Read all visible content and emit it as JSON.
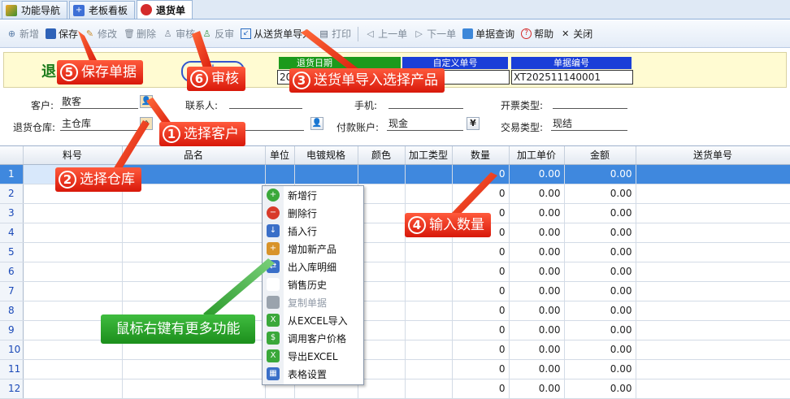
{
  "tabs": [
    {
      "label": "功能导航"
    },
    {
      "label": "老板看板"
    },
    {
      "label": "退货单"
    }
  ],
  "toolbar": {
    "new": "新增",
    "save": "保存",
    "edit": "修改",
    "delete": "删除",
    "audit": "审核",
    "unaudit": "反审",
    "import": "从送货单导入",
    "print": "打印",
    "prev": "上一单",
    "next": "下一单",
    "query": "单据查询",
    "help": "帮助",
    "close": "关闭"
  },
  "header": {
    "title": "退",
    "stamp": "未",
    "return_date_label": "退货日期",
    "return_date_value": "20",
    "custom_no_label": "自定义单号",
    "custom_no_value": "",
    "doc_no_label": "单据编号",
    "doc_no_value": "XT202511140001"
  },
  "form": {
    "customer_label": "客户:",
    "customer_value": "散客",
    "contact_label": "联系人:",
    "contact_value": "",
    "phone_label": "手机:",
    "phone_value": "",
    "invoice_label": "开票类型:",
    "invoice_value": "",
    "warehouse_label": "退货仓库:",
    "warehouse_value": "主仓库",
    "account_label": "付款账户:",
    "account_value": "现金",
    "currency_icon": "¥",
    "trade_label": "交易类型:",
    "trade_value": "现结"
  },
  "grid": {
    "columns": [
      "",
      "料号",
      "品名",
      "单位",
      "电镀规格",
      "颜色",
      "加工类型",
      "数量",
      "加工单价",
      "金额",
      "送货单号"
    ],
    "rows": [
      {
        "n": "1",
        "qty": "0",
        "price": "0.00",
        "amount": "0.00"
      },
      {
        "n": "2",
        "qty": "0",
        "price": "0.00",
        "amount": "0.00"
      },
      {
        "n": "3",
        "qty": "0",
        "price": "0.00",
        "amount": "0.00"
      },
      {
        "n": "4",
        "qty": "0",
        "price": "0.00",
        "amount": "0.00"
      },
      {
        "n": "5",
        "qty": "0",
        "price": "0.00",
        "amount": "0.00"
      },
      {
        "n": "6",
        "qty": "0",
        "price": "0.00",
        "amount": "0.00"
      },
      {
        "n": "7",
        "qty": "0",
        "price": "0.00",
        "amount": "0.00"
      },
      {
        "n": "8",
        "qty": "0",
        "price": "0.00",
        "amount": "0.00"
      },
      {
        "n": "9",
        "qty": "0",
        "price": "0.00",
        "amount": "0.00"
      },
      {
        "n": "10",
        "qty": "0",
        "price": "0.00",
        "amount": "0.00"
      },
      {
        "n": "11",
        "qty": "0",
        "price": "0.00",
        "amount": "0.00"
      },
      {
        "n": "12",
        "qty": "0",
        "price": "0.00",
        "amount": "0.00"
      }
    ]
  },
  "context_menu": {
    "items": [
      {
        "label": "新增行",
        "icon": "plus-circle-icon",
        "enabled": true
      },
      {
        "label": "删除行",
        "icon": "minus-circle-icon",
        "enabled": true
      },
      {
        "label": "插入行",
        "icon": "insert-row-icon",
        "enabled": true
      },
      {
        "label": "增加新产品",
        "icon": "add-product-icon",
        "enabled": true
      },
      {
        "label": "出入库明细",
        "icon": "stock-detail-icon",
        "enabled": true
      },
      {
        "label": "销售历史",
        "icon": "sales-history-icon",
        "enabled": true
      },
      {
        "label": "复制单据",
        "icon": "copy-document-icon",
        "enabled": false
      },
      {
        "label": "从EXCEL导入",
        "icon": "excel-import-icon",
        "enabled": true
      },
      {
        "label": "调用客户价格",
        "icon": "customer-price-icon",
        "enabled": true
      },
      {
        "label": "导出EXCEL",
        "icon": "excel-export-icon",
        "enabled": true
      },
      {
        "label": "表格设置",
        "icon": "table-settings-icon",
        "enabled": true
      }
    ]
  },
  "callouts": {
    "c1": {
      "num": "1",
      "text": "选择客户"
    },
    "c2": {
      "num": "2",
      "text": "选择仓库"
    },
    "c3": {
      "num": "3",
      "text": "送货单导入选择产品"
    },
    "c4": {
      "num": "4",
      "text": "输入数量"
    },
    "c5": {
      "num": "5",
      "text": "保存单据"
    },
    "c6": {
      "num": "6",
      "text": "审核"
    },
    "tip": "鼠标右键有更多功能"
  },
  "colors": {
    "selected_row": "#3f88de",
    "callout": "#e8281a",
    "tip": "#2aa52a",
    "header_blue": "#1a3fd8",
    "header_green": "#1c9a1c"
  }
}
